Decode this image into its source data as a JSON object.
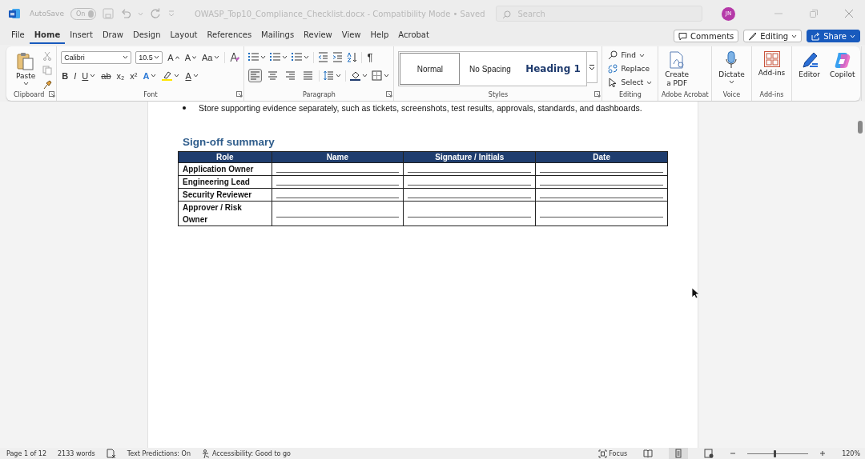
{
  "title_bar": {
    "autosave": {
      "label": "AutoSave",
      "toggle_label": "On",
      "on": true
    },
    "document_title": "OWASP_Top10_Compliance_Checklist.docx  -  Compatibility Mode • Saved",
    "search": {
      "placeholder": "Search"
    },
    "avatar": "JN"
  },
  "menu_tabs": [
    {
      "label": "File",
      "selected": false
    },
    {
      "label": "Home",
      "selected": true
    },
    {
      "label": "Insert",
      "selected": false
    },
    {
      "label": "Draw",
      "selected": false
    },
    {
      "label": "Design",
      "selected": false
    },
    {
      "label": "Layout",
      "selected": false
    },
    {
      "label": "References",
      "selected": false
    },
    {
      "label": "Mailings",
      "selected": false
    },
    {
      "label": "Review",
      "selected": false
    },
    {
      "label": "View",
      "selected": false
    },
    {
      "label": "Help",
      "selected": false
    },
    {
      "label": "Acrobat",
      "selected": false
    }
  ],
  "header_buttons": {
    "comments": "Comments",
    "editing": "Editing",
    "share": "Share"
  },
  "ribbon": {
    "clipboard": {
      "paste": "Paste",
      "label": "Clipboard"
    },
    "font": {
      "name": "Calibri",
      "size": "10.5",
      "grow": "A",
      "shrink": "A",
      "case": "Aa",
      "bold": "B",
      "italic": "I",
      "underline": "U",
      "strike": "ab",
      "subscript": "x₂",
      "superscript": "x²",
      "effects": "A",
      "font_color_glyph": "A",
      "label": "Font"
    },
    "paragraph": {
      "pilcrow": "¶",
      "alignment": [
        {
          "selected": true
        },
        {
          "selected": false
        },
        {
          "selected": false
        },
        {
          "selected": false
        }
      ],
      "label": "Paragraph"
    },
    "styles": {
      "items": [
        {
          "label": "Normal",
          "selected": true
        },
        {
          "label": "No Spacing",
          "selected": false
        },
        {
          "label": "Heading 1",
          "selected": false
        }
      ],
      "label": "Styles"
    },
    "editing": {
      "items": [
        "Find",
        "Replace",
        "Select"
      ],
      "label": "Editing"
    },
    "acrobat": {
      "button": [
        "Create",
        "a PDF"
      ],
      "label": "Adobe Acrobat"
    },
    "voice": {
      "button": "Dictate",
      "label": "Voice"
    },
    "addins": {
      "button": "Add-ins",
      "label": "Add-ins"
    },
    "tools": [
      "Editor",
      "Copilot"
    ]
  },
  "document": {
    "bullet": "Store supporting evidence separately, such as tickets, screenshots, test results, approvals, standards, and dashboards.",
    "heading": "Sign-off summary",
    "table": {
      "columns": [
        "Role",
        "Name",
        "Signature / Initials",
        "Date"
      ],
      "rows": [
        {
          "role": "Application Owner"
        },
        {
          "role": "Engineering Lead"
        },
        {
          "role": "Security Reviewer"
        },
        {
          "role": "Approver / Risk Owner"
        }
      ]
    }
  },
  "status_bar": {
    "page": "Page 1 of 12",
    "words": "2133 words",
    "text_predictions": "Text Predictions: On",
    "accessibility": "Accessibility: Good to go",
    "focus": "Focus",
    "views": [
      {
        "selected": false
      },
      {
        "selected": true
      },
      {
        "selected": false
      }
    ],
    "zoom": {
      "level": 0.43,
      "reading": "120%"
    }
  }
}
